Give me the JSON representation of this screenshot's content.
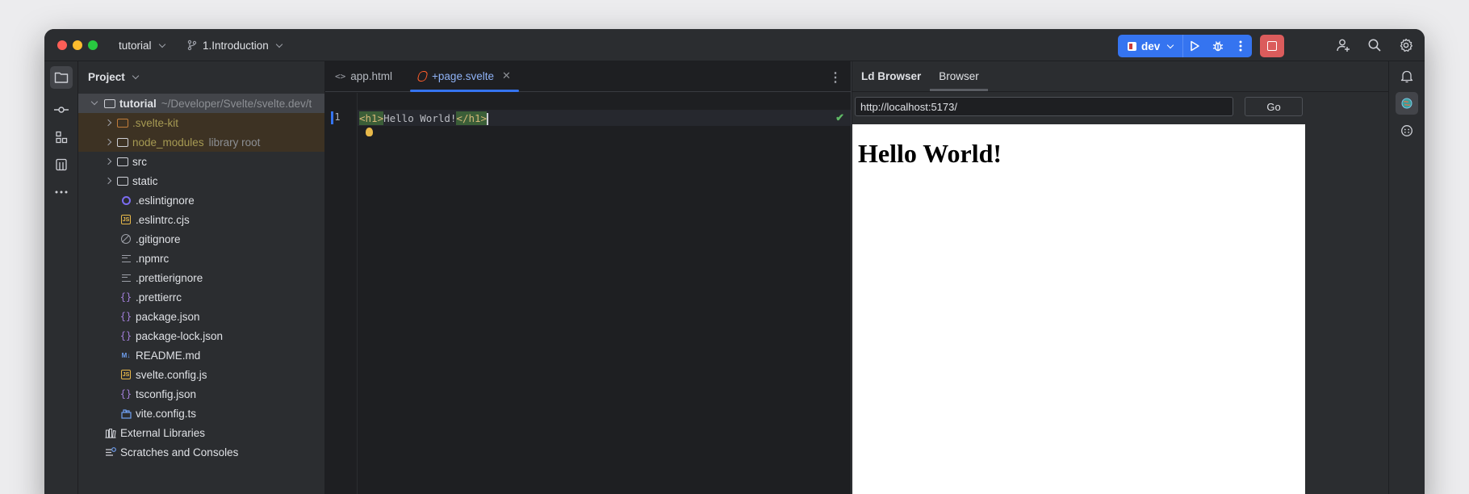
{
  "titlebar": {
    "project_name": "tutorial",
    "branch_name": "1.Introduction",
    "run_config": "dev"
  },
  "project_panel": {
    "title": "Project",
    "tree": [
      {
        "name": "tutorial",
        "hint": "~/Developer/Svelte/svelte.dev/t",
        "type": "folder-root"
      },
      {
        "name": ".svelte-kit",
        "hint": "",
        "type": "folder-excluded"
      },
      {
        "name": "node_modules",
        "hint": "library root",
        "type": "folder-excluded"
      },
      {
        "name": "src",
        "hint": "",
        "type": "folder"
      },
      {
        "name": "static",
        "hint": "",
        "type": "folder"
      },
      {
        "name": ".eslintignore",
        "hint": "",
        "type": "eslint"
      },
      {
        "name": ".eslintrc.cjs",
        "hint": "",
        "type": "js"
      },
      {
        "name": ".gitignore",
        "hint": "",
        "type": "ignore"
      },
      {
        "name": ".npmrc",
        "hint": "",
        "type": "text"
      },
      {
        "name": ".prettierignore",
        "hint": "",
        "type": "text"
      },
      {
        "name": ".prettierrc",
        "hint": "",
        "type": "json"
      },
      {
        "name": "package.json",
        "hint": "",
        "type": "json"
      },
      {
        "name": "package-lock.json",
        "hint": "",
        "type": "json"
      },
      {
        "name": "README.md",
        "hint": "",
        "type": "md"
      },
      {
        "name": "svelte.config.js",
        "hint": "",
        "type": "js"
      },
      {
        "name": "tsconfig.json",
        "hint": "",
        "type": "json"
      },
      {
        "name": "vite.config.ts",
        "hint": "",
        "type": "vite"
      },
      {
        "name": "External Libraries",
        "hint": "",
        "type": "libs"
      },
      {
        "name": "Scratches and Consoles",
        "hint": "",
        "type": "scratch"
      }
    ]
  },
  "editor": {
    "tabs": [
      {
        "label": "app.html"
      },
      {
        "label": "+page.svelte"
      }
    ],
    "line_number": "1",
    "code": {
      "open_tag": "<h1>",
      "text": "Hello World!",
      "close_tag": "</h1>"
    }
  },
  "browser": {
    "panel_title": "Ld Browser",
    "tab_label": "Browser",
    "url": "http://localhost:5173/",
    "go_label": "Go",
    "page_heading": "Hello World!"
  },
  "colors": {
    "accent": "#3574f0",
    "stop": "#db5c5c",
    "excluded_bg": "#3d3223"
  }
}
